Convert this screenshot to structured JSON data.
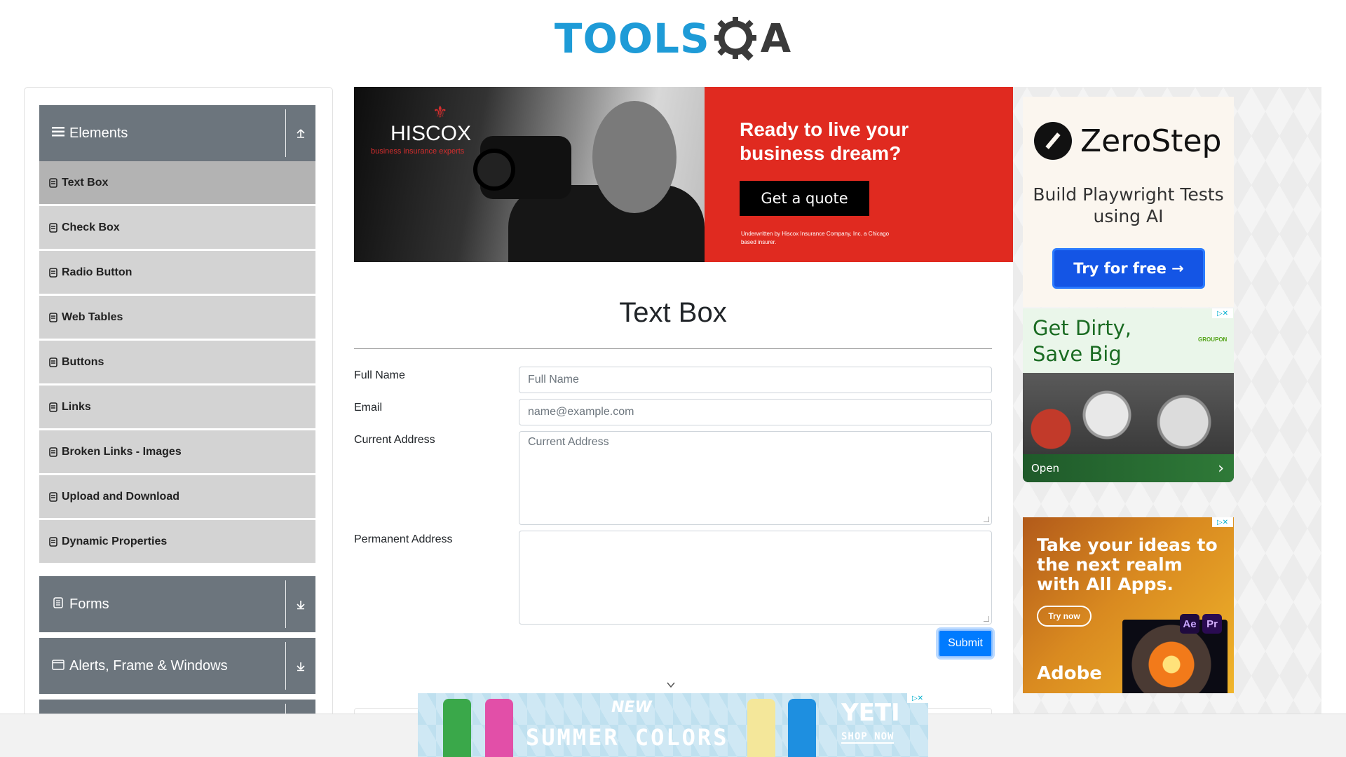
{
  "logo": {
    "text_tools": "TOOLS",
    "text_qa": "QA"
  },
  "sidebar": {
    "groups": [
      {
        "label": "Elements",
        "icon": "hamburger-icon",
        "state": "expanded"
      },
      {
        "label": "Forms",
        "icon": "document-icon",
        "state": "collapsed"
      },
      {
        "label": "Alerts, Frame & Windows",
        "icon": "window-icon",
        "state": "collapsed"
      }
    ],
    "items": [
      {
        "label": "Text Box",
        "active": true
      },
      {
        "label": "Check Box"
      },
      {
        "label": "Radio Button"
      },
      {
        "label": "Web Tables"
      },
      {
        "label": "Buttons"
      },
      {
        "label": "Links"
      },
      {
        "label": "Broken Links - Images"
      },
      {
        "label": "Upload and Download"
      },
      {
        "label": "Dynamic Properties"
      }
    ]
  },
  "top_ad": {
    "brand": "HISCOX",
    "tagline": "business insurance experts",
    "headline": "Ready to live your business dream?",
    "button": "Get a quote",
    "fineprint": "Underwritten by Hiscox Insurance Company, Inc. a Chicago based insurer."
  },
  "form": {
    "title": "Text Box",
    "fields": [
      {
        "label": "Full Name",
        "placeholder": "Full Name",
        "value": ""
      },
      {
        "label": "Email",
        "placeholder": "name@example.com",
        "value": ""
      },
      {
        "label": "Current Address",
        "placeholder": "Current Address",
        "value": ""
      },
      {
        "label": "Permanent Address",
        "placeholder": "",
        "value": ""
      }
    ],
    "submit": "Submit"
  },
  "right_ads": {
    "zerostep": {
      "brand": "ZeroStep",
      "subtitle": "Build Playwright Tests using AI",
      "button": "Try for free →"
    },
    "groupon": {
      "title": "Get Dirty, Save Big",
      "brand": "GROUPON",
      "open": "Open"
    },
    "adobe": {
      "headline": "Take your ideas to the next realm with All Apps.",
      "button": "Try now",
      "app1": "Ae",
      "app2": "Pr",
      "brand": "Adobe"
    }
  },
  "bottom_ad": {
    "new": "NEW",
    "headline": "SUMMER COLORS",
    "brand": "YETI",
    "cta": "SHOP NOW"
  },
  "colors": {
    "accent": "#007bff",
    "sidebar_group": "#6c757d",
    "sidebar_item": "#d3d3d3",
    "logo_blue": "#1e9bd7"
  }
}
